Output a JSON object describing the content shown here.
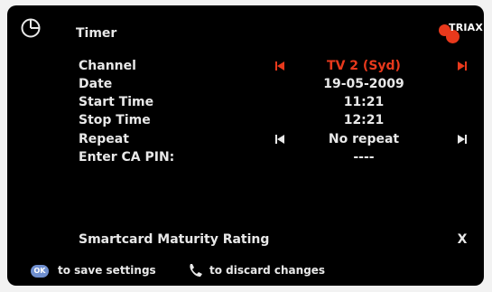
{
  "header": {
    "title": "Timer",
    "brand": "TRIAX",
    "icon": "clock-icon"
  },
  "fields": {
    "channel": {
      "label": "Channel",
      "value": "TV 2 (Syd)"
    },
    "date": {
      "label": "Date",
      "value": "19-05-2009"
    },
    "start_time": {
      "label": "Start Time",
      "value": "11:21"
    },
    "stop_time": {
      "label": "Stop Time",
      "value": "12:21"
    },
    "repeat": {
      "label": "Repeat",
      "value": "No repeat"
    },
    "ca_pin": {
      "label": "Enter CA PIN:",
      "value": "----"
    },
    "maturity": {
      "label": "Smartcard Maturity Rating",
      "value": "X"
    }
  },
  "footer": {
    "ok_label": "OK",
    "save_text": "to save settings",
    "discard_text": "to discard changes"
  },
  "colors": {
    "highlight": "#e8391c",
    "text": "#e8e8e8",
    "background": "#000000"
  }
}
